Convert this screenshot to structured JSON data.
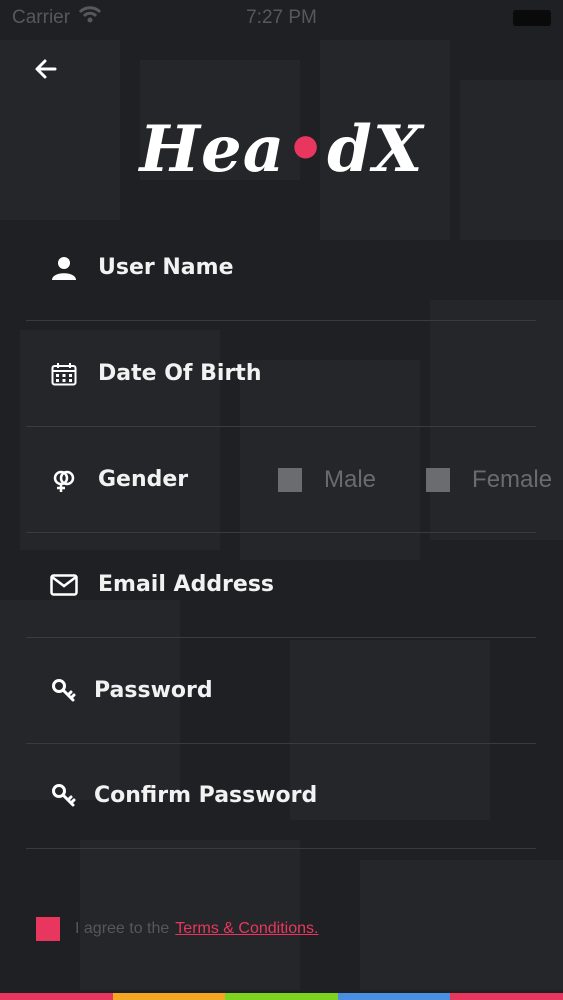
{
  "status_bar": {
    "carrier": "Carrier",
    "time": "7:27 PM"
  },
  "logo": {
    "part1": "Hea",
    "dot": "•",
    "part2": "dX"
  },
  "fields": {
    "username": "User Name",
    "dob": "Date Of Birth",
    "gender": "Gender",
    "email": "Email Address",
    "password": "Password",
    "confirm_password": "Confirm Password"
  },
  "gender_options": {
    "male": "Male",
    "female": "Female"
  },
  "agreement": {
    "text": "I agree to the",
    "link": "Terms & Conditions."
  },
  "colors": {
    "accent": "#e9365f",
    "stripe": [
      "#e9365f",
      "#f5a623",
      "#7ed321",
      "#4a90e2",
      "#e9365f"
    ]
  }
}
